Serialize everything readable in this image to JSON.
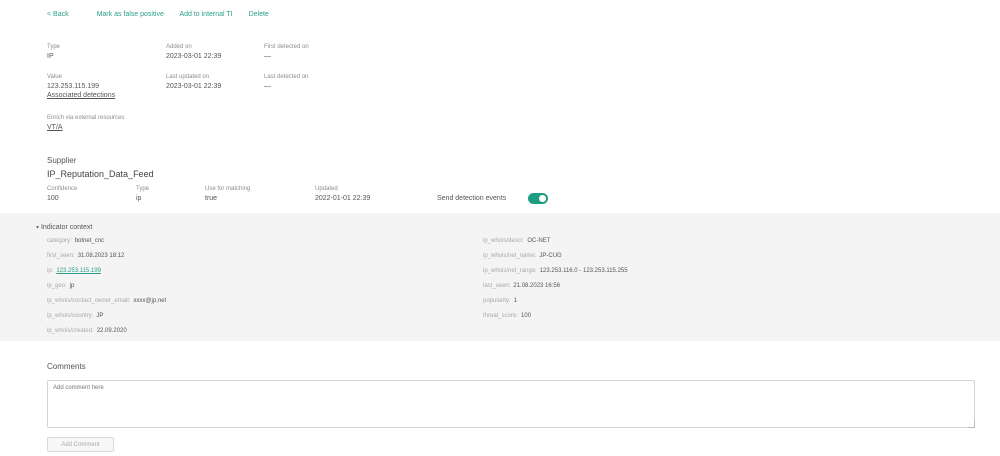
{
  "toolbar": {
    "back": "< Back",
    "false_positive": "Mark as false positive",
    "add_internal_ti": "Add to internal TI",
    "delete": "Delete"
  },
  "details": {
    "type_label": "Type",
    "type_value": "IP",
    "added_on_label": "Added on",
    "added_on_value": "2023-03-01 22:39",
    "first_detected_label": "First detected on",
    "first_detected_value": "—",
    "value_label": "Value",
    "value_value": "123.253.115.199",
    "associated_detections": "Associated detections",
    "last_updated_label": "Last updated on",
    "last_updated_value": "2023-03-01 22:39",
    "last_detected_label": "Last detected on",
    "last_detected_value": "—",
    "enrich_label": "Enrich via external resources",
    "enrich_link": "VT/A"
  },
  "supplier": {
    "heading": "Supplier",
    "name": "IP_Reputation_Data_Feed",
    "confidence_label": "Confidence",
    "confidence_value": "100",
    "type_label": "Type",
    "type_value": "ip",
    "matching_label": "Use for matching",
    "matching_value": "true",
    "updated_label": "Updated",
    "updated_value": "2022-01-01 22:39",
    "send_events_label": "Send detection events",
    "send_events_on": true
  },
  "context": {
    "title": "Indicator context",
    "left": [
      {
        "k": "category:",
        "v": "botnet_cnc",
        "link": false
      },
      {
        "k": "first_seen:",
        "v": "31.08.2023 18:12",
        "link": false
      },
      {
        "k": "ip:",
        "v": "123.253.115.199",
        "link": true
      },
      {
        "k": "ip_geo:",
        "v": "jp",
        "link": false
      },
      {
        "k": "ip_whois/contact_owner_email:",
        "v": "xxxx@jp.net",
        "link": false
      },
      {
        "k": "ip_whois/country:",
        "v": "JP",
        "link": false
      },
      {
        "k": "ip_whois/created:",
        "v": "22.09.2020",
        "link": false
      }
    ],
    "right": [
      {
        "k": "ip_whois/descr:",
        "v": "OC-NET",
        "link": false
      },
      {
        "k": "ip_whois/net_name:",
        "v": "JP-CUG",
        "link": false
      },
      {
        "k": "ip_whois/net_range:",
        "v": "123.253.116.0 - 123.253.115.255",
        "link": false
      },
      {
        "k": "last_seen:",
        "v": "21.08.2023 16:56",
        "link": false
      },
      {
        "k": "popularity:",
        "v": "1",
        "link": false
      },
      {
        "k": "threat_score:",
        "v": "100",
        "link": false
      }
    ]
  },
  "comments": {
    "title": "Comments",
    "placeholder": "Add comment here",
    "add_button": "Add Comment"
  }
}
